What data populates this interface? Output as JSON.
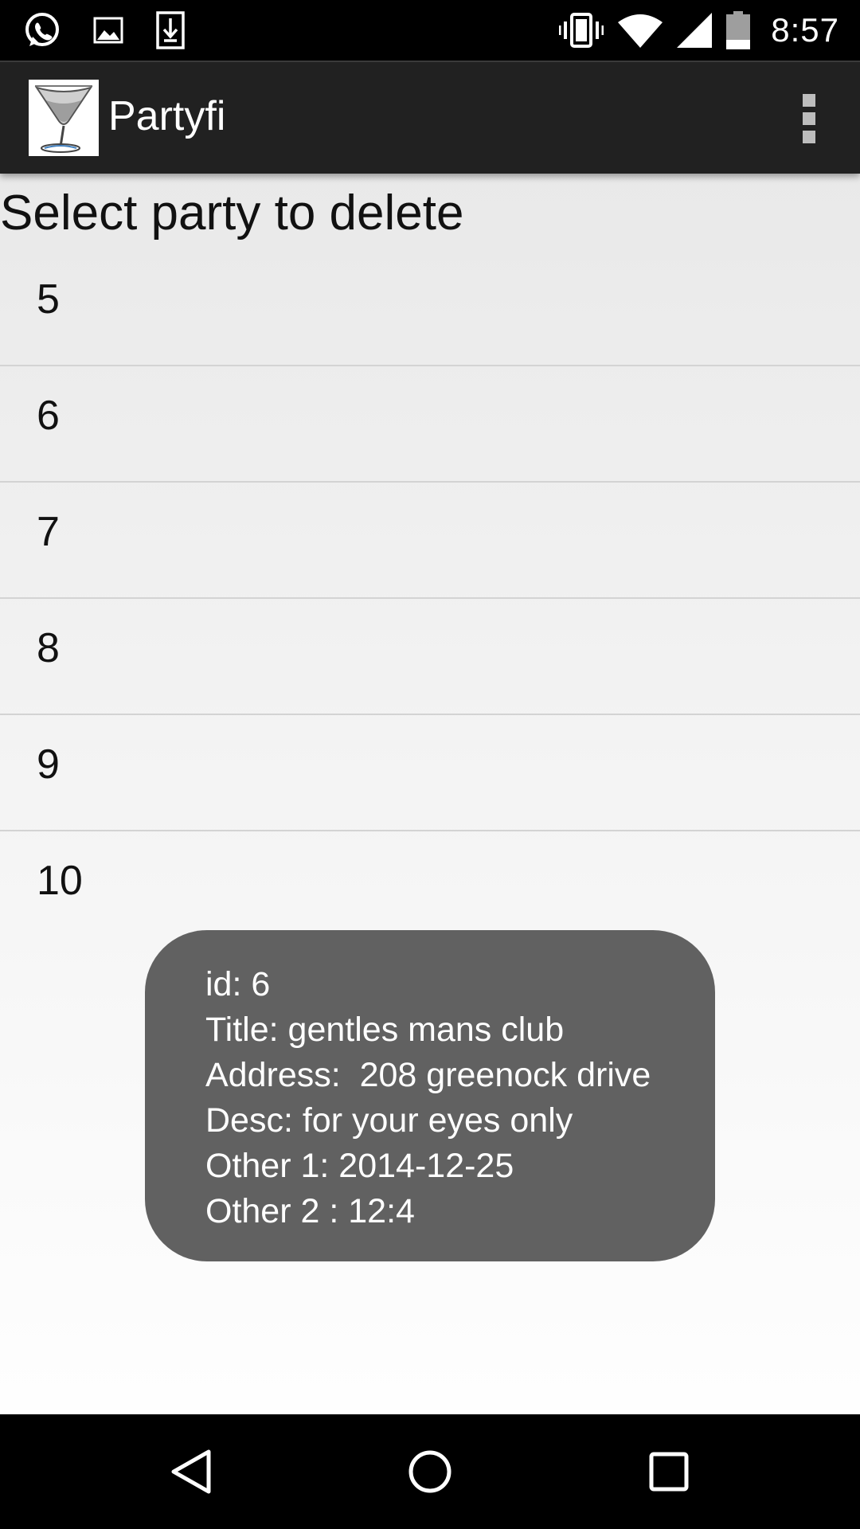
{
  "status_bar": {
    "time": "8:57",
    "notification_icons": [
      "whatsapp-icon",
      "image-icon",
      "download-icon"
    ],
    "system_icons": [
      "vibrate-icon",
      "wifi-icon",
      "signal-icon",
      "battery-icon"
    ]
  },
  "action_bar": {
    "title": "Partyfi",
    "app_icon": "cocktail-glass-icon",
    "overflow_icon": "more-vertical-icon"
  },
  "page": {
    "heading": "Select party to delete",
    "parties": [
      "5",
      "6",
      "7",
      "8",
      "9",
      "10"
    ]
  },
  "toast": {
    "lines": [
      "id: 6",
      "Title: gentles mans club",
      "Address:  208 greenock drive",
      "Desc: for your eyes only",
      "Other 1: 2014-12-25",
      "Other 2 : 12:4"
    ]
  },
  "nav_bar": {
    "buttons": [
      "back-icon",
      "home-icon",
      "recents-icon"
    ]
  },
  "colors": {
    "action_bar": "#212121",
    "toast": "#616161",
    "text": "#111111"
  }
}
